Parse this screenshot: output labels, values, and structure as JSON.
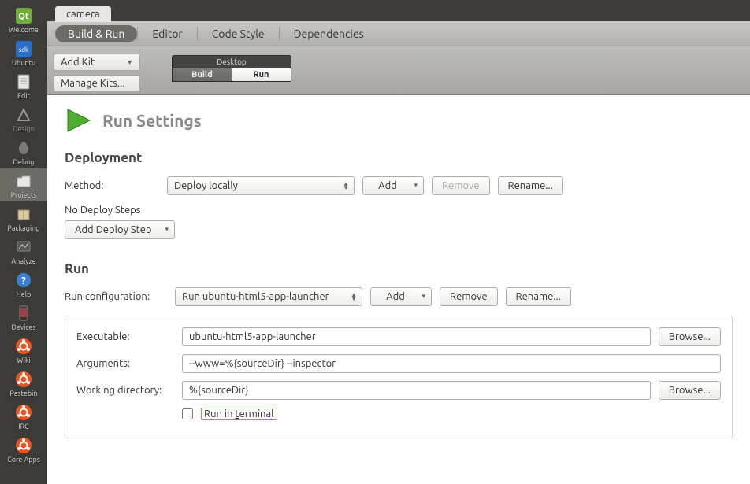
{
  "project_tab": "camera",
  "sidebar": [
    {
      "label": "Welcome"
    },
    {
      "label": "Ubuntu"
    },
    {
      "label": "Edit"
    },
    {
      "label": "Design"
    },
    {
      "label": "Debug"
    },
    {
      "label": "Projects"
    },
    {
      "label": "Packaging"
    },
    {
      "label": "Analyze"
    },
    {
      "label": "Help"
    },
    {
      "label": "Devices"
    },
    {
      "label": "Wiki"
    },
    {
      "label": "Pastebin"
    },
    {
      "label": "IRC"
    },
    {
      "label": "Core Apps"
    }
  ],
  "subnav": {
    "build_run": "Build & Run",
    "editor": "Editor",
    "code_style": "Code Style",
    "dependencies": "Dependencies"
  },
  "kitbar": {
    "add_kit": "Add Kit",
    "manage_kits": "Manage Kits...",
    "kit_name": "Desktop",
    "build": "Build",
    "run": "Run"
  },
  "page": {
    "title": "Run Settings",
    "deployment": {
      "heading": "Deployment",
      "method_label": "Method:",
      "method_value": "Deploy locally",
      "add": "Add",
      "remove": "Remove",
      "rename": "Rename...",
      "no_steps": "No Deploy Steps",
      "add_step": "Add Deploy Step"
    },
    "run": {
      "heading": "Run",
      "config_label": "Run configuration:",
      "config_value": "Run ubuntu-html5-app-launcher",
      "add": "Add",
      "remove": "Remove",
      "rename": "Rename...",
      "exe_label": "Executable:",
      "exe_value": "ubuntu-html5-app-launcher",
      "args_label": "Arguments:",
      "args_value": "--www=%{sourceDir} --inspector",
      "wd_label": "Working directory:",
      "wd_value": "%{sourceDir}",
      "browse": "Browse...",
      "terminal": "Run in terminal"
    }
  }
}
